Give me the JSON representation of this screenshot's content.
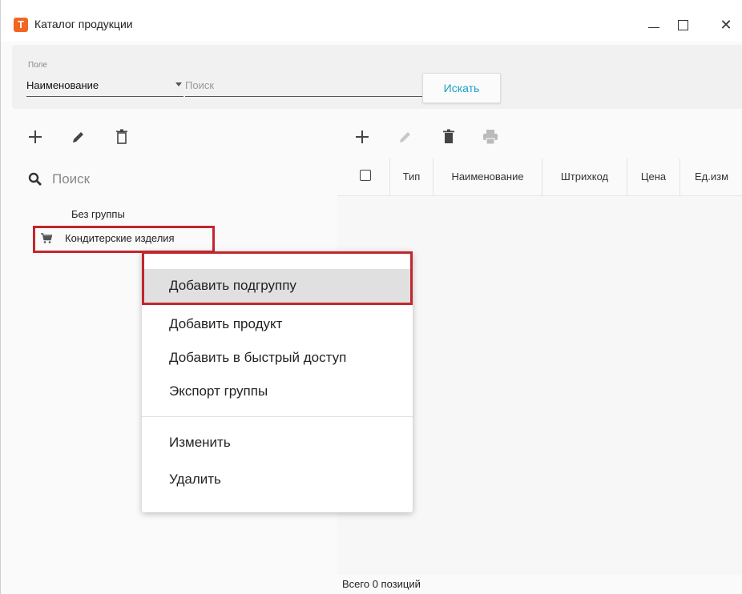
{
  "window": {
    "title": "Каталог продукции",
    "app_icon_letter": "T",
    "controls": {
      "minimize": "minimize",
      "maximize": "maximize",
      "close": "✕"
    }
  },
  "search": {
    "field_caption": "Поле",
    "field_value": "Наименование",
    "placeholder": "Поиск",
    "button_label": "Искать"
  },
  "left_toolbar": {
    "icons": [
      "add-icon",
      "edit-icon",
      "delete-icon"
    ]
  },
  "right_toolbar": {
    "icons": [
      "add-icon",
      "edit-icon",
      "delete-icon",
      "print-icon"
    ]
  },
  "tree": {
    "search_placeholder": "Поиск",
    "items": [
      {
        "label": "Без группы"
      },
      {
        "label": "Кондитерские изделия",
        "icon": "cart-icon",
        "highlighted": true
      }
    ]
  },
  "grid": {
    "columns": [
      "Тип",
      "Наименование",
      "Штрихкод",
      "Цена",
      "Ед.изм"
    ],
    "footer": "Всего 0 позиций"
  },
  "context_menu": {
    "items": [
      {
        "label": "Добавить подгруппу",
        "hover": true
      },
      {
        "label": "Добавить продукт"
      },
      {
        "label": "Добавить в быстрый доступ"
      },
      {
        "label": "Экспорт группы"
      },
      {
        "label": "Изменить"
      },
      {
        "label": "Удалить"
      }
    ]
  },
  "colors": {
    "accent": "#1aa0c8",
    "highlight": "#c1272d",
    "app_icon": "#f26522"
  }
}
